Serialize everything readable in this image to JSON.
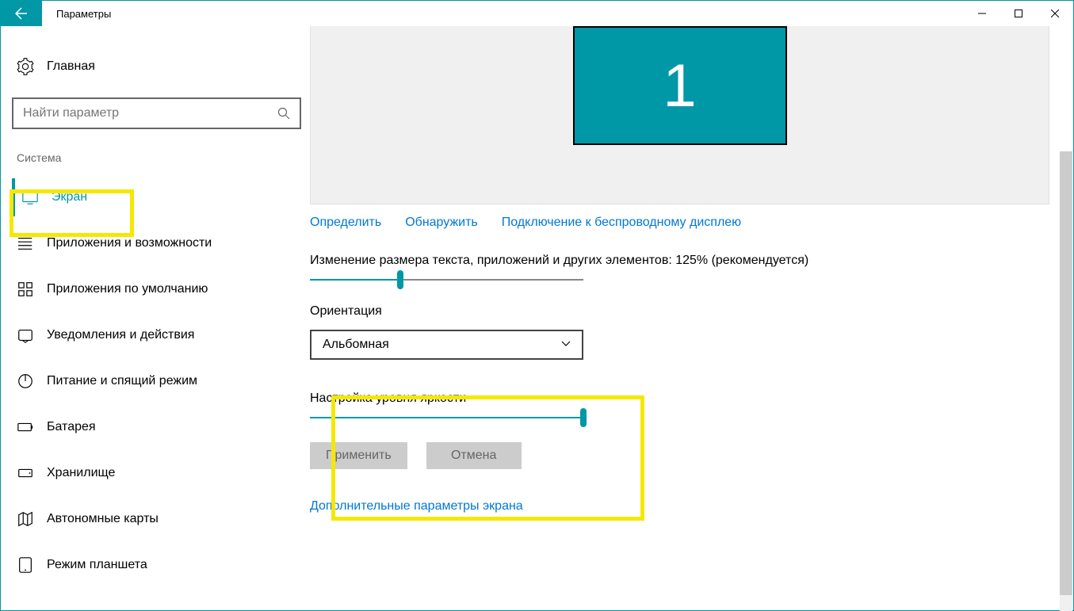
{
  "window": {
    "title": "Параметры"
  },
  "sidebar": {
    "home": "Главная",
    "search_placeholder": "Найти параметр",
    "section": "Система",
    "items": [
      {
        "label": "Экран",
        "icon": "display-icon",
        "active": true
      },
      {
        "label": "Приложения и возможности",
        "icon": "apps-icon"
      },
      {
        "label": "Приложения по умолчанию",
        "icon": "default-apps-icon"
      },
      {
        "label": "Уведомления и действия",
        "icon": "notifications-icon"
      },
      {
        "label": "Питание и спящий режим",
        "icon": "power-icon"
      },
      {
        "label": "Батарея",
        "icon": "battery-icon"
      },
      {
        "label": "Хранилище",
        "icon": "storage-icon"
      },
      {
        "label": "Автономные карты",
        "icon": "maps-icon"
      },
      {
        "label": "Режим планшета",
        "icon": "tablet-icon"
      }
    ]
  },
  "main": {
    "monitor_number": "1",
    "links": {
      "identify": "Определить",
      "detect": "Обнаружить",
      "wireless": "Подключение к беспроводному дисплею"
    },
    "scale_label": "Изменение размера текста, приложений и других элементов: 125% (рекомендуется)",
    "scale_percent": 33,
    "orientation_label": "Ориентация",
    "orientation_value": "Альбомная",
    "brightness_label": "Настройка уровня яркости",
    "brightness_percent": 100,
    "buttons": {
      "apply": "Применить",
      "cancel": "Отмена"
    },
    "advanced_link": "Дополнительные параметры экрана"
  }
}
